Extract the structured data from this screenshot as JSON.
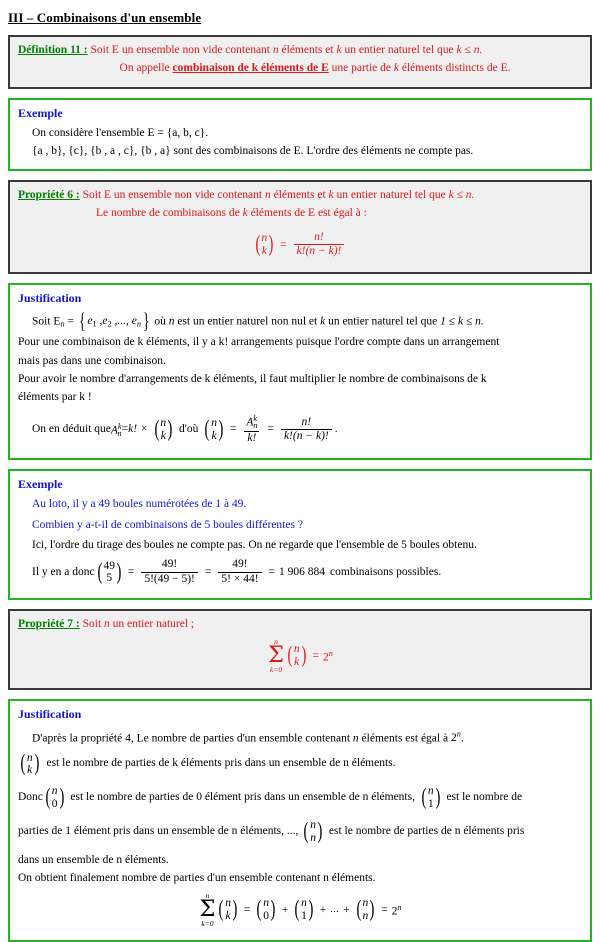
{
  "document": {
    "section_title": "III – Combinaisons d'un ensemble",
    "colors": {
      "label_green": "#008000",
      "body_red": "#e01818",
      "body_blue": "#1515cf",
      "box_border_dark": "#3a3a3a",
      "box_border_green": "#22b422",
      "box_background_gray": "#f0f0f0"
    }
  },
  "definition11": {
    "label": "Définition 11 :",
    "line1_a": "Soit E un ensemble non vide contenant ",
    "line1_n": "n",
    "line1_b": " éléments et ",
    "line1_k": "k",
    "line1_c": " un entier naturel tel que ",
    "line1_cond": "k ≤ n.",
    "line2_a": "On appelle ",
    "line2_bold": "combinaison de k éléments de E",
    "line2_b": " une partie de ",
    "line2_k": "k",
    "line2_c": " éléments distincts de E."
  },
  "example1": {
    "header": "Exemple",
    "line1": "On considère l'ensemble E = {a, b, c}.",
    "line2": "{a , b}, {c}, {b , a , c}, {b , a} sont des combinaisons de E. L'ordre des éléments ne compte pas."
  },
  "propriete6": {
    "label": "Propriété 6 :",
    "line1_a": "Soit E un ensemble non vide contenant ",
    "line1_n": "n",
    "line1_b": " éléments et ",
    "line1_k": "k",
    "line1_c": " un entier naturel tel que ",
    "line1_cond": "k ≤ n.",
    "line2_a": "Le nombre de combinaisons de ",
    "line2_k": "k",
    "line2_b": " éléments de E est égal à :",
    "formula": {
      "binom_top": "n",
      "binom_bottom": "k",
      "equals": "=",
      "frac_num": "n!",
      "frac_den": "k!(n − k)!"
    }
  },
  "justification1": {
    "header": "Justification",
    "l1_a": "Soit E",
    "l1_sub": "n",
    "l1_eq": " = ",
    "l1_set": "e1 , e2 ,..., en",
    "l1_b": " où ",
    "l1_n": "n",
    "l1_c": " est un entier naturel non nul et ",
    "l1_k": "k",
    "l1_d": " un entier naturel tel que ",
    "l1_cond": "1 ≤ k ≤ n.",
    "l2": "Pour une combinaison de k éléments, il y a k! arrangements puisque l'ordre compte dans un arrangement",
    "l3": "mais pas dans une combinaison.",
    "l4": "Pour avoir le nombre d'arrangements de k éléments, il faut multiplier le nombre de combinaisons de k",
    "l5": "éléments par k !",
    "l6_prefix": "On en déduit que ",
    "l6_Asym": "A",
    "l6_Asub": "n",
    "l6_Asup": "k",
    "l6_eq1": " = ",
    "l6_kfact": "k!",
    "l6_times": "×",
    "l6_dou": "d'où",
    "l6_frac1_num": "A",
    "l6_frac1_den": "k!",
    "l6_frac2_num": "n!",
    "l6_frac2_den": "k!(n − k)!",
    "l6_end": "."
  },
  "example2": {
    "header": "Exemple",
    "line1": "Au loto, il y a 49 boules numérotées de 1 à 49.",
    "line2": "Combien y a-t-il de combinaisons de 5 boules différentes ?",
    "line3": "Ici, l'ordre du tirage des boules ne compte pas. On ne regarde que l'ensemble de 5 boules obtenu.",
    "line4_prefix": "Il y en a donc ",
    "binom_top": "49",
    "binom_bottom": "5",
    "frac1_num": "49!",
    "frac1_den": "5!(49 − 5)!",
    "frac2_num": "49!",
    "frac2_den": "5! × 44!",
    "result": "1 906 884",
    "line4_suffix": "combinaisons possibles."
  },
  "propriete7": {
    "label": "Propriété 7 :",
    "line1_a": "Soit ",
    "line1_n": "n",
    "line1_b": " un entier naturel ;",
    "formula": {
      "sum_upper": "n",
      "sum_lower": "k=0",
      "binom_top": "n",
      "binom_bottom": "k",
      "equals": "=",
      "rhs_base": "2",
      "rhs_exp": "n"
    }
  },
  "justification2": {
    "header": "Justification",
    "l1_a": "D'après la propriété 4, Le nombre de parties d'un ensemble contenant ",
    "l1_n": "n",
    "l1_b": " éléments est égal à ",
    "l1_base": "2",
    "l1_exp": "n",
    "l1_end": ".",
    "l2_binom_top": "n",
    "l2_binom_bottom": "k",
    "l2_text": "est le nombre de parties de k éléments pris dans un ensemble de n éléments.",
    "l3_donc": "Donc",
    "l3_b1_top": "n",
    "l3_b1_bottom": "0",
    "l3_mid": "est le nombre de parties de 0 élément pris dans un ensemble de n éléments,",
    "l3_b2_top": "n",
    "l3_b2_bottom": "1",
    "l3_end": "est le nombre de",
    "l4_a": "parties de 1 élément pris dans un ensemble de n éléments, ...,",
    "l4_b3_top": "n",
    "l4_b3_bottom": "n",
    "l4_b": "est le nombre de parties de n éléments pris",
    "l5": "dans un ensemble de n éléments.",
    "l6": "On obtient finalement nombre de parties d'un ensemble contenant n éléments.",
    "formula": {
      "sum_upper": "n",
      "sum_lower": "k=0",
      "b0_top": "n",
      "b0_bottom": "k",
      "eq1": "=",
      "b1_top": "n",
      "b1_bottom": "0",
      "plus1": "+",
      "b2_top": "n",
      "b2_bottom": "1",
      "plus2": "+",
      "dots": "...",
      "plus3": "+",
      "b3_top": "n",
      "b3_bottom": "n",
      "eq2": "=",
      "rhs_base": "2",
      "rhs_exp": "n"
    }
  }
}
